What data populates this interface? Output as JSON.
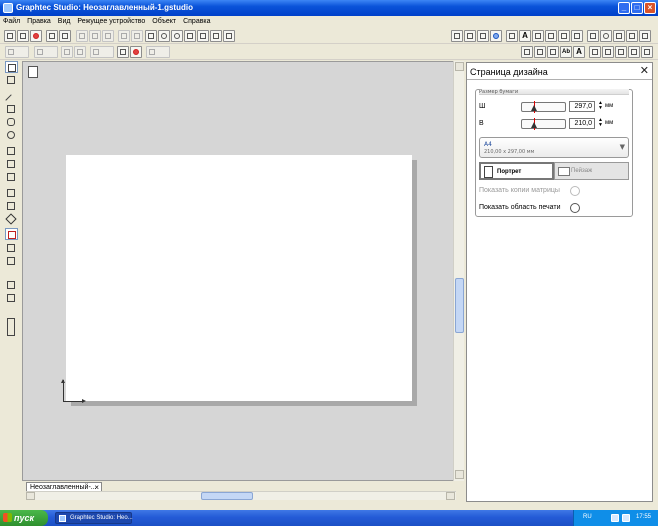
{
  "window": {
    "title": "Graphtec Studio: Неозаглавленный-1.gstudio"
  },
  "menu": [
    "Файл",
    "Правка",
    "Вид",
    "Режущее устройство",
    "Объект",
    "Справка"
  ],
  "document_tab": {
    "label": "Неозаглавленный-..."
  },
  "panel": {
    "title": "Страница дизайна",
    "group_label": "Размер бумаги",
    "width_label": "Ш",
    "width_value": "297,0",
    "height_label": "В",
    "height_value": "210,0",
    "unit": "мм",
    "paper_name": "A4",
    "paper_size": "210,00 x 297,00 мм",
    "portrait_label": "Портрет",
    "landscape_label": "Пейзаж",
    "show_matrix_copies": "Показать копии матрицы",
    "show_print_area": "Показать область печати"
  },
  "taskbar": {
    "start": "пуск",
    "task": "Graphtec Studio: Нео...",
    "lang": "RU",
    "clock": "17:55"
  }
}
